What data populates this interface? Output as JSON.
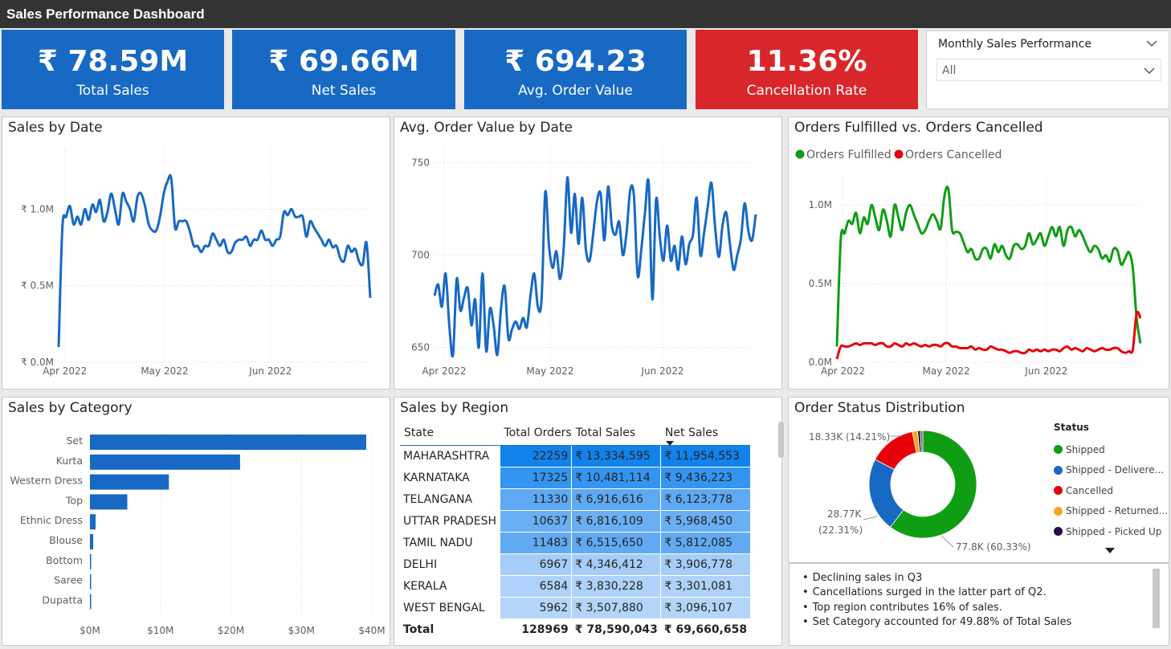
{
  "header": {
    "title": "Sales Performance Dashboard"
  },
  "kpis": [
    {
      "value": "₹ 78.59M",
      "label": "Total Sales",
      "color": "#1769c4"
    },
    {
      "value": "₹ 69.66M",
      "label": "Net Sales",
      "color": "#1769c4"
    },
    {
      "value": "₹ 694.23",
      "label": "Avg. Order Value",
      "color": "#1769c4"
    },
    {
      "value": "11.36%",
      "label": "Cancellation Rate",
      "color": "#d9262a"
    }
  ],
  "slicer": {
    "title": "Monthly Sales Performance",
    "selected": "All",
    "expand_icon": "chevron-down-icon"
  },
  "sales_by_date": {
    "title": "Sales by Date"
  },
  "aov_by_date": {
    "title": "Avg. Order Value by Date"
  },
  "orders_chart": {
    "title": "Orders Fulfilled vs. Orders Cancelled"
  },
  "sales_by_category": {
    "title": "Sales by Category"
  },
  "sales_by_region": {
    "title": "Sales by Region",
    "headers": [
      "State",
      "Total Orders",
      "Total Sales",
      "Net Sales"
    ],
    "sort_icon": "sort-descending-icon",
    "rows": [
      [
        "MAHARASHTRA",
        "22259",
        "₹ 13,334,595",
        "₹ 11,954,553"
      ],
      [
        "KARNATAKA",
        "17325",
        "₹ 10,481,114",
        "₹ 9,436,223"
      ],
      [
        "TELANGANA",
        "11330",
        "₹ 6,916,616",
        "₹ 6,123,778"
      ],
      [
        "UTTAR PRADESH",
        "10637",
        "₹ 6,816,109",
        "₹ 5,968,450"
      ],
      [
        "TAMIL NADU",
        "11483",
        "₹ 6,515,650",
        "₹ 5,812,085"
      ],
      [
        "DELHI",
        "6967",
        "₹ 4,346,412",
        "₹ 3,906,778"
      ],
      [
        "KERALA",
        "6584",
        "₹ 3,830,228",
        "₹ 3,301,081"
      ],
      [
        "WEST BENGAL",
        "5962",
        "₹ 3,507,880",
        "₹ 3,096,107"
      ]
    ],
    "total": [
      "Total",
      "128969",
      "₹ 78,590,043",
      "₹ 69,660,658"
    ]
  },
  "order_status": {
    "title": "Order Status Distribution",
    "legend_title": "Status",
    "more_icon": "caret-down-icon"
  },
  "notes": [
    "Declining sales in Q3",
    "Cancellations surged in the latter part of Q2.",
    "Top region contributes 16% of sales.",
    "Set Category accounted for 49.88% of Total Sales"
  ],
  "chart_data": [
    {
      "type": "line",
      "title": "Sales by Date",
      "x_ticks": [
        "Apr 2022",
        "May 2022",
        "Jun 2022"
      ],
      "y_ticks": [
        "₹ 0.0M",
        "₹ 0.5M",
        "₹ 1.0M"
      ],
      "ylim": [
        0,
        1.4
      ],
      "grid": true,
      "color": "#1769c4",
      "series": [
        {
          "values": [
            0.1,
            0.88,
            0.95,
            1.02,
            0.9,
            0.95,
            0.9,
            1.0,
            0.93,
            1.03,
            0.98,
            1.06,
            0.92,
            0.98,
            1.1,
            1.0,
            0.9,
            1.1,
            1.05,
            1.0,
            0.92,
            1.08,
            1.1,
            1.02,
            0.9,
            0.86,
            0.86,
            0.95,
            1.1,
            1.18,
            1.2,
            0.88,
            0.92,
            0.92,
            0.92,
            0.85,
            0.76,
            0.76,
            0.72,
            0.76,
            0.76,
            0.84,
            0.8,
            0.76,
            0.8,
            0.72,
            0.72,
            0.78,
            0.8,
            0.8,
            0.82,
            0.76,
            0.8,
            0.8,
            0.86,
            0.8,
            0.8,
            0.76,
            0.8,
            0.82,
            0.98,
            0.96,
            1.0,
            0.95,
            0.95,
            0.95,
            0.82,
            0.92,
            0.88,
            0.84,
            0.8,
            0.76,
            0.8,
            0.75,
            0.76,
            0.68,
            0.66,
            0.76,
            0.72,
            0.74,
            0.66,
            0.64,
            0.78,
            0.42
          ]
        }
      ]
    },
    {
      "type": "line",
      "title": "Avg. Order Value by Date",
      "x_ticks": [
        "Apr 2022",
        "May 2022",
        "Jun 2022"
      ],
      "y_ticks": [
        650,
        700,
        750
      ],
      "ylim": [
        642,
        758
      ],
      "grid": true,
      "color": "#1769c4",
      "series": [
        {
          "values": [
            678,
            684,
            672,
            690,
            662,
            646,
            687,
            670,
            677,
            682,
            662,
            676,
            650,
            690,
            648,
            671,
            662,
            646,
            671,
            683,
            655,
            660,
            664,
            660,
            666,
            661,
            678,
            690,
            672,
            676,
            734,
            705,
            693,
            702,
            687,
            704,
            742,
            712,
            733,
            706,
            731,
            703,
            697,
            712,
            729,
            733,
            708,
            737,
            716,
            711,
            718,
            700,
            712,
            735,
            732,
            689,
            703,
            723,
            739,
            676,
            730,
            710,
            697,
            716,
            697,
            705,
            692,
            710,
            695,
            706,
            711,
            731,
            700,
            712,
            726,
            739,
            715,
            699,
            716,
            723,
            706,
            692,
            700,
            709,
            728,
            713,
            708,
            722
          ]
        }
      ]
    },
    {
      "type": "line",
      "title": "Orders Fulfilled vs. Orders Cancelled",
      "x_ticks": [
        "Apr 2022",
        "May 2022",
        "Jun 2022"
      ],
      "y_ticks": [
        "0.0M",
        "0.5M",
        "1.0M"
      ],
      "ylim": [
        0,
        1.2
      ],
      "grid": true,
      "legend_position": "top-left",
      "series": [
        {
          "name": "Orders Fulfilled",
          "color": "#0f9d14",
          "values": [
            0.1,
            0.78,
            0.82,
            0.9,
            0.88,
            0.95,
            0.82,
            0.92,
            0.88,
            1.0,
            0.92,
            0.84,
            0.97,
            0.9,
            0.8,
            1.0,
            0.92,
            0.84,
            0.95,
            1.0,
            0.94,
            0.88,
            0.82,
            0.84,
            0.9,
            0.94,
            0.9,
            0.85,
            1.06,
            1.1,
            0.84,
            0.83,
            0.82,
            0.76,
            0.7,
            0.72,
            0.66,
            0.66,
            0.72,
            0.72,
            0.66,
            0.75,
            0.7,
            0.74,
            0.68,
            0.66,
            0.74,
            0.75,
            0.72,
            0.74,
            0.82,
            0.75,
            0.78,
            0.82,
            0.74,
            0.8,
            0.86,
            0.8,
            0.86,
            0.74,
            0.84,
            0.86,
            0.8,
            0.84,
            0.8,
            0.74,
            0.7,
            0.74,
            0.72,
            0.66,
            0.68,
            0.64,
            0.72,
            0.71,
            0.62,
            0.66,
            0.7,
            0.6,
            0.28,
            0.12
          ]
        },
        {
          "name": "Orders Cancelled",
          "color": "#e8000b",
          "values": [
            0.02,
            0.1,
            0.1,
            0.1,
            0.11,
            0.12,
            0.11,
            0.12,
            0.12,
            0.12,
            0.11,
            0.12,
            0.12,
            0.1,
            0.1,
            0.12,
            0.11,
            0.1,
            0.12,
            0.11,
            0.12,
            0.11,
            0.1,
            0.11,
            0.1,
            0.11,
            0.11,
            0.1,
            0.12,
            0.12,
            0.1,
            0.1,
            0.09,
            0.09,
            0.09,
            0.1,
            0.08,
            0.09,
            0.08,
            0.08,
            0.1,
            0.09,
            0.08,
            0.08,
            0.07,
            0.06,
            0.07,
            0.07,
            0.06,
            0.06,
            0.08,
            0.07,
            0.08,
            0.07,
            0.08,
            0.07,
            0.08,
            0.08,
            0.07,
            0.09,
            0.1,
            0.08,
            0.09,
            0.08,
            0.07,
            0.09,
            0.08,
            0.07,
            0.08,
            0.09,
            0.08,
            0.08,
            0.09,
            0.09,
            0.07,
            0.06,
            0.07,
            0.08,
            0.31,
            0.28
          ]
        }
      ]
    },
    {
      "type": "bar",
      "orientation": "horizontal",
      "title": "Sales by Category",
      "categories": [
        "Set",
        "Kurta",
        "Western Dress",
        "Top",
        "Ethnic Dress",
        "Blouse",
        "Bottom",
        "Saree",
        "Dupatta"
      ],
      "values": [
        39.2,
        21.3,
        11.2,
        5.3,
        0.8,
        0.46,
        0.15,
        0.12,
        0.0
      ],
      "x_ticks": [
        "$0M",
        "$10M",
        "$20M",
        "$30M",
        "$40M"
      ],
      "xlim": [
        0,
        40
      ],
      "color": "#1769c4"
    },
    {
      "type": "pie",
      "title": "Order Status Distribution",
      "donut": true,
      "slices": [
        {
          "name": "Shipped",
          "value": 60.33,
          "label": "77.8K (60.33%)",
          "color": "#0f9d14"
        },
        {
          "name": "Shipped - Delivere...",
          "value": 22.31,
          "label": "28.77K (22.31%)",
          "color": "#1769c4"
        },
        {
          "name": "Cancelled",
          "value": 14.21,
          "label": "18.33K (14.21%)",
          "color": "#e8000b"
        },
        {
          "name": "Shipped - Returned...",
          "value": 1.6,
          "label": "",
          "color": "#f5a623"
        },
        {
          "name": "Shipped - Picked Up",
          "value": 0.8,
          "label": "",
          "color": "#2d0a45"
        },
        {
          "name": "",
          "value": 0.75,
          "label": "",
          "color": "#6b6b6b"
        }
      ]
    }
  ]
}
